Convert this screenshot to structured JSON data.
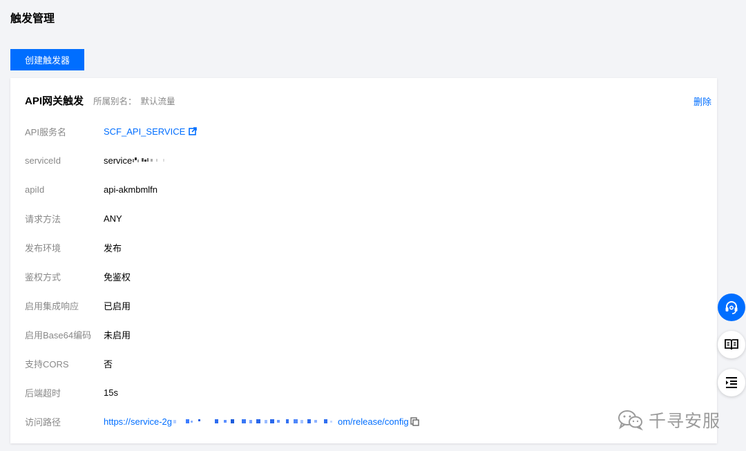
{
  "page": {
    "title": "触发管理",
    "create_button": "创建触发器"
  },
  "trigger": {
    "title": "API网关触发",
    "alias_label": "所属别名：",
    "alias_value": "默认流量",
    "delete_label": "删除",
    "rows": [
      {
        "label": "API服务名",
        "value": "SCF_API_SERVICE"
      },
      {
        "label": "serviceId",
        "value": "service"
      },
      {
        "label": "apiId",
        "value": "api-akmbmlfn"
      },
      {
        "label": "请求方法",
        "value": "ANY"
      },
      {
        "label": "发布环境",
        "value": "发布"
      },
      {
        "label": "鉴权方式",
        "value": "免鉴权"
      },
      {
        "label": "启用集成响应",
        "value": "已启用"
      },
      {
        "label": "启用Base64编码",
        "value": "未启用"
      },
      {
        "label": "支持CORS",
        "value": "否"
      },
      {
        "label": "后端超时",
        "value": "15s"
      },
      {
        "label": "访问路径",
        "value_prefix": "https://service-2g",
        "value_suffix": "om/release/config"
      }
    ]
  },
  "watermark": {
    "text": "千寻安服"
  },
  "colors": {
    "accent": "#006eff",
    "label": "#888888",
    "background": "#f3f4f7"
  },
  "icons": {
    "external_link": "external-link-icon",
    "copy": "copy-icon",
    "support": "headset-icon",
    "docs": "book-icon",
    "menu": "indent-menu-icon",
    "watermark": "wechat-icon"
  }
}
